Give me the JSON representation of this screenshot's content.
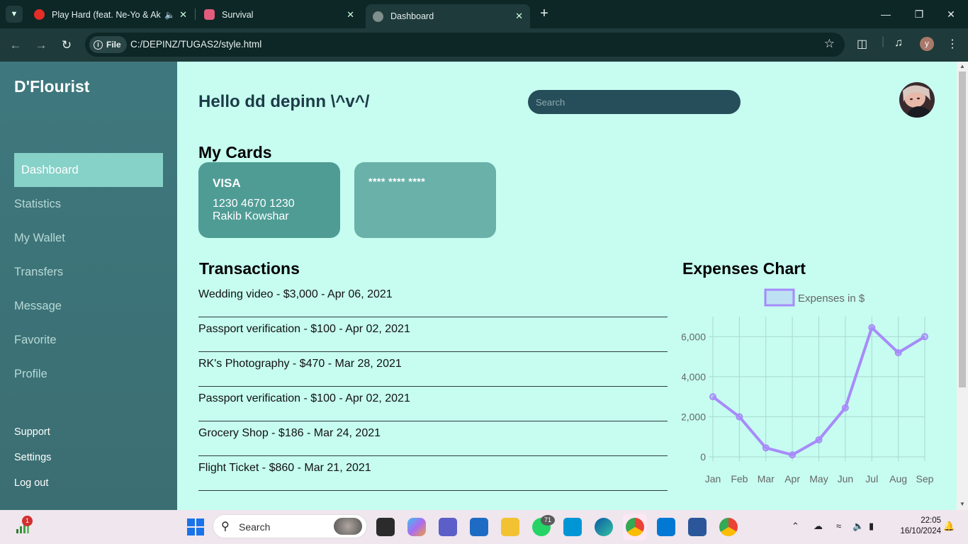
{
  "browser": {
    "tabs": [
      {
        "title": "Play Hard (feat. Ne-Yo & Ak",
        "favicon_color": "#e52d27"
      },
      {
        "title": "Survival",
        "favicon_color": "#e35c7d"
      },
      {
        "title": "Dashboard",
        "favicon_color": "#7f8f8d"
      }
    ],
    "address": {
      "chip": "File",
      "url": "C:/DEPINZ/TUGAS2/style.html"
    },
    "profile_initial": "y"
  },
  "sidebar": {
    "brand": "D'Flourist",
    "items": [
      "Dashboard",
      "Statistics",
      "My Wallet",
      "Transfers",
      "Message",
      "Favorite",
      "Profile"
    ],
    "active_index": 0,
    "footer": [
      "Support",
      "Settings",
      "Log out"
    ]
  },
  "header": {
    "greeting": "Hello dd depinn \\^v^/",
    "search_placeholder": "Search"
  },
  "cards": {
    "title": "My Cards",
    "card1": {
      "brand": "VISA",
      "number": "1230 4670 1230",
      "holder": "Rakib Kowshar"
    },
    "card2": {
      "masked": "**** **** ****"
    }
  },
  "transactions": {
    "title": "Transactions",
    "rows": [
      "Wedding video - $3,000 - Apr 06, 2021",
      "Passport verification - $100 - Apr 02, 2021",
      "RK's Photography - $470 - Mar 28, 2021",
      "Passport verification - $100 - Apr 02, 2021",
      "Grocery Shop - $186 - Mar 24, 2021",
      "Flight Ticket - $860 - Mar 21, 2021"
    ]
  },
  "chart_data": {
    "type": "line",
    "title": "Expenses Chart",
    "categories": [
      "Jan",
      "Feb",
      "Mar",
      "Apr",
      "May",
      "Jun",
      "Jul",
      "Aug",
      "Sep"
    ],
    "series": [
      {
        "name": "Expenses in $",
        "values": [
          3000,
          2000,
          450,
          100,
          850,
          2450,
          6450,
          5200,
          6000
        ],
        "color": "#a78bfa"
      }
    ],
    "yticks": [
      "0",
      "2,000",
      "4,000",
      "6,000"
    ],
    "ylim": [
      0,
      7000
    ],
    "grid": true,
    "legend": "top"
  },
  "taskbar": {
    "search_label": "Search",
    "teams_badge": "71",
    "signal_badge": "1",
    "clock_time": "22:05",
    "clock_date": "16/10/2024"
  }
}
